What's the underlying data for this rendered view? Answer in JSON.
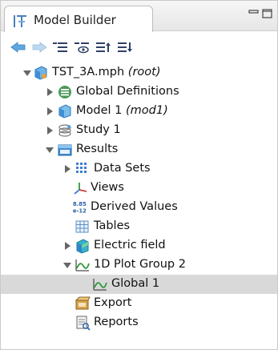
{
  "window": {
    "title": "Model Builder",
    "minimize_icon": "minimize-icon",
    "maximize_icon": "maximize-icon"
  },
  "toolbar": {
    "buttons": [
      {
        "icon": "back-arrow-icon"
      },
      {
        "icon": "forward-arrow-icon"
      },
      {
        "icon": "collapse-list-icon"
      },
      {
        "icon": "show-hide-icon"
      },
      {
        "icon": "move-up-list-icon"
      },
      {
        "icon": "move-down-list-icon"
      }
    ]
  },
  "tree": {
    "root": {
      "label": "TST_3A.mph",
      "tag": "(root)"
    },
    "global_definitions": {
      "label": "Global Definitions"
    },
    "model": {
      "label": "Model 1",
      "tag": "(mod1)"
    },
    "study": {
      "label": "Study 1"
    },
    "results": {
      "label": "Results",
      "children": {
        "data_sets": {
          "label": "Data Sets"
        },
        "views": {
          "label": "Views"
        },
        "derived_values": {
          "label": "Derived Values",
          "icon_text_top": "8.85",
          "icon_text_bottom": "e-12"
        },
        "tables": {
          "label": "Tables"
        },
        "electric_field": {
          "label": "Electric field"
        },
        "plot_group": {
          "label": "1D Plot Group 2",
          "children": {
            "global": {
              "label": "Global 1"
            }
          }
        },
        "export": {
          "label": "Export"
        },
        "reports": {
          "label": "Reports"
        }
      }
    }
  },
  "colors": {
    "selection": "#d9d9d9",
    "nav_arrow": "#5fa8e0",
    "folder": "#3e8fd6",
    "grid": "#3c7fd0",
    "plot_line": "#2d9a3a"
  }
}
